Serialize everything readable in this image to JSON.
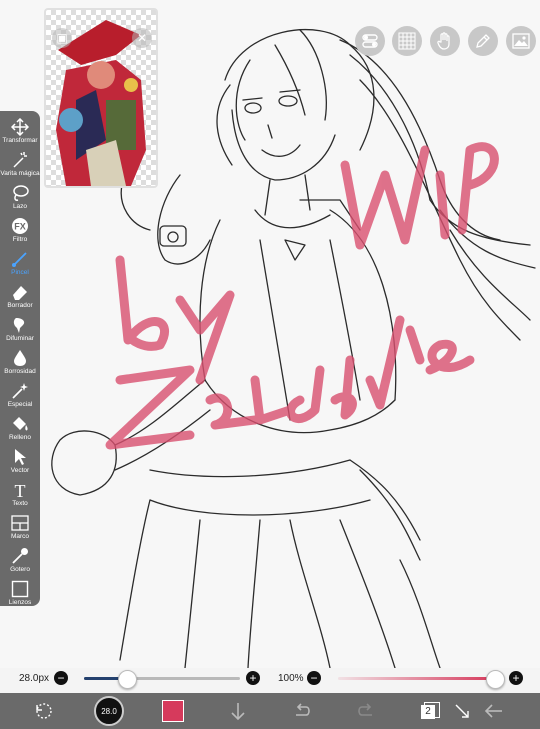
{
  "reference": {
    "lock_icon": "lock-icon",
    "close_icon": "close-icon"
  },
  "top_toolbar": {
    "items": [
      {
        "name": "toggle-icon"
      },
      {
        "name": "grid-icon"
      },
      {
        "name": "hand-icon"
      },
      {
        "name": "pen-icon"
      },
      {
        "name": "image-icon"
      }
    ]
  },
  "watermark": {
    "line1": "WiP",
    "line2": "by",
    "line3": "Zeldarie"
  },
  "tools": [
    {
      "label": "Transformar",
      "icon": "move-icon"
    },
    {
      "label": "Varita mágica",
      "icon": "magic-wand-icon"
    },
    {
      "label": "Lazo",
      "icon": "lasso-icon"
    },
    {
      "label": "Filtro",
      "icon": "fx-icon"
    },
    {
      "label": "Pincel",
      "icon": "brush-icon",
      "active": true
    },
    {
      "label": "Borrador",
      "icon": "eraser-icon"
    },
    {
      "label": "Difuminar",
      "icon": "smudge-icon"
    },
    {
      "label": "Borrosidad",
      "icon": "blur-icon"
    },
    {
      "label": "Especial",
      "icon": "special-icon"
    },
    {
      "label": "Relleno",
      "icon": "fill-icon"
    },
    {
      "label": "Vector",
      "icon": "vector-icon"
    },
    {
      "label": "Texto",
      "icon": "text-icon"
    },
    {
      "label": "Marco",
      "icon": "frame-icon"
    },
    {
      "label": "Gotero",
      "icon": "eyedropper-icon"
    },
    {
      "label": "Lienzos",
      "icon": "canvas-icon"
    }
  ],
  "brush": {
    "size_label": "28.0px",
    "size_fraction": 0.27,
    "opacity_label": "100%",
    "opacity_fraction": 1.0,
    "opacity_color": "#d63a5c"
  },
  "bottom_bar": {
    "brush_size_badge": "28.0",
    "current_color": "#d63a5c",
    "layer_count": "2"
  },
  "colors": {
    "toolbar_bg": "#6a6a6a",
    "active_tool": "#4aa3ff",
    "watermark": "#d9506f"
  }
}
